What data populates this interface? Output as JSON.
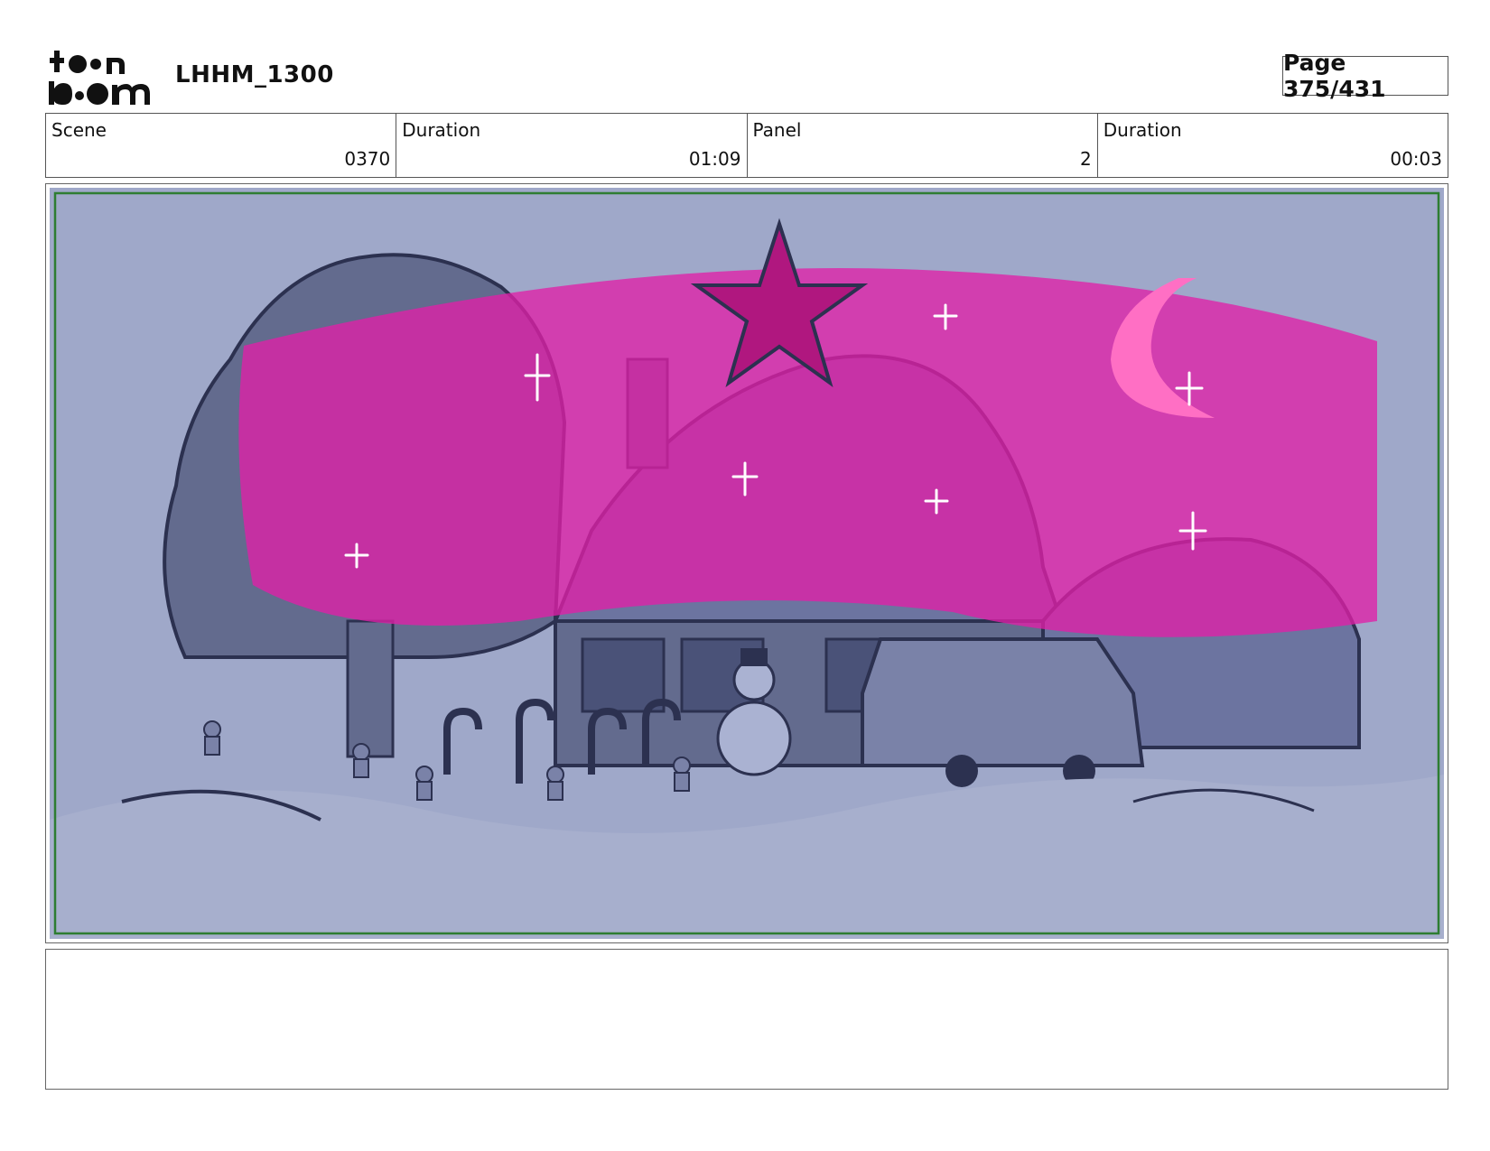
{
  "header": {
    "logo_text_top": "toon",
    "logo_text_bottom": "boom",
    "project_title": "LHHM_1300",
    "page_label": "Page 375/431"
  },
  "info": [
    {
      "label": "Scene",
      "value": "0370"
    },
    {
      "label": "Duration",
      "value": "01:09"
    },
    {
      "label": "Panel",
      "value": "2"
    },
    {
      "label": "Duration",
      "value": "00:03"
    }
  ],
  "panel": {
    "description_icon": "storyboard-drawing",
    "colors": {
      "sky": "#9fa8c9",
      "ink": "#2c3150",
      "shadow": "#636b8e",
      "highlight": "#e020a8",
      "safe_frame": "#2e7d32"
    }
  },
  "notes": {
    "text": ""
  }
}
